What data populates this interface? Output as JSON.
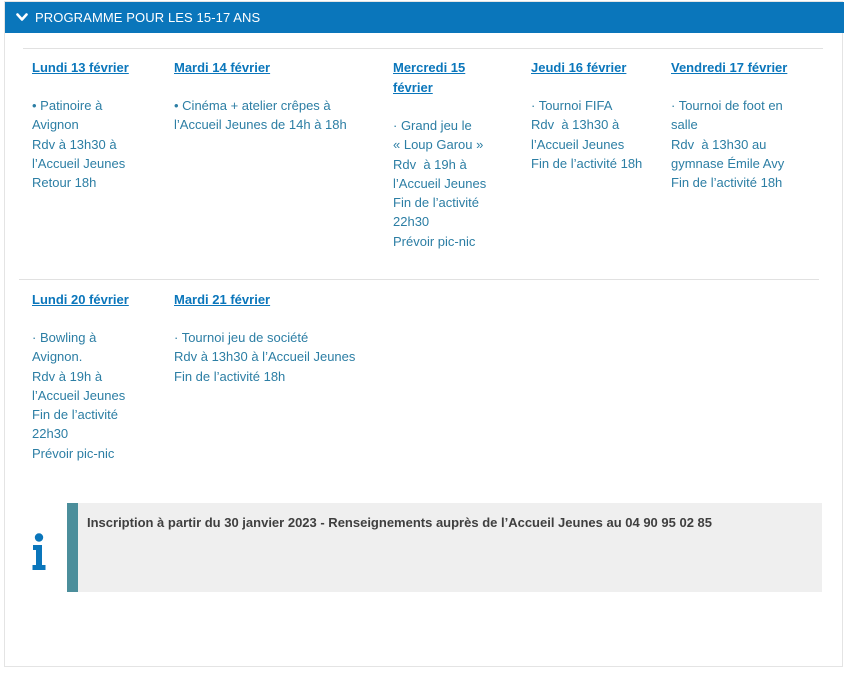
{
  "header": {
    "title": "PROGRAMME POUR LES 15-17 ANS",
    "icon": "chevron-down-icon",
    "bg_color": "#0a76bb"
  },
  "week1": [
    {
      "day": "Lundi 13 février",
      "lines": [
        "• Patinoire à",
        "Avignon",
        "Rdv à 13h30 à",
        "l’Accueil Jeunes",
        "Retour 18h"
      ]
    },
    {
      "day": "Mardi 14 février",
      "lines": [
        "• Cinéma + atelier crêpes à",
        "l’Accueil Jeunes de 14h à 18h"
      ]
    },
    {
      "day_line1": "Mercredi 15",
      "day_line2": "février",
      "lines": [
        "· Grand jeu le",
        "« Loup Garou »",
        "Rdv  à 19h à",
        "l’Accueil Jeunes",
        "Fin de l’activité",
        "22h30",
        "Prévoir pic-nic"
      ]
    },
    {
      "day": "Jeudi 16 février",
      "lines": [
        "· Tournoi FIFA",
        "Rdv  à 13h30 à",
        "l’Accueil Jeunes",
        "Fin de l’activité 18h"
      ]
    },
    {
      "day": "Vendredi 17 février",
      "lines": [
        "· Tournoi de foot en",
        "salle",
        "Rdv  à 13h30 au",
        "gymnase Émile Avy",
        "Fin de l’activité 18h"
      ]
    }
  ],
  "week2": [
    {
      "day": "Lundi 20 février",
      "lines": [
        "· Bowling à",
        "Avignon.",
        "Rdv à 19h à",
        "l’Accueil Jeunes",
        "Fin de l’activité",
        "22h30",
        "Prévoir pic-nic"
      ]
    },
    {
      "day": "Mardi 21 février",
      "lines": [
        "· Tournoi jeu de société",
        "Rdv à 13h30 à l’Accueil Jeunes",
        "Fin de l’activité 18h"
      ]
    }
  ],
  "info": {
    "text": "Inscription à partir du 30 janvier 2023 - Renseignements auprès de l’Accueil Jeunes au 04 90 95 02 85",
    "icon": "info-icon",
    "accent_color": "#4b8e9b"
  }
}
